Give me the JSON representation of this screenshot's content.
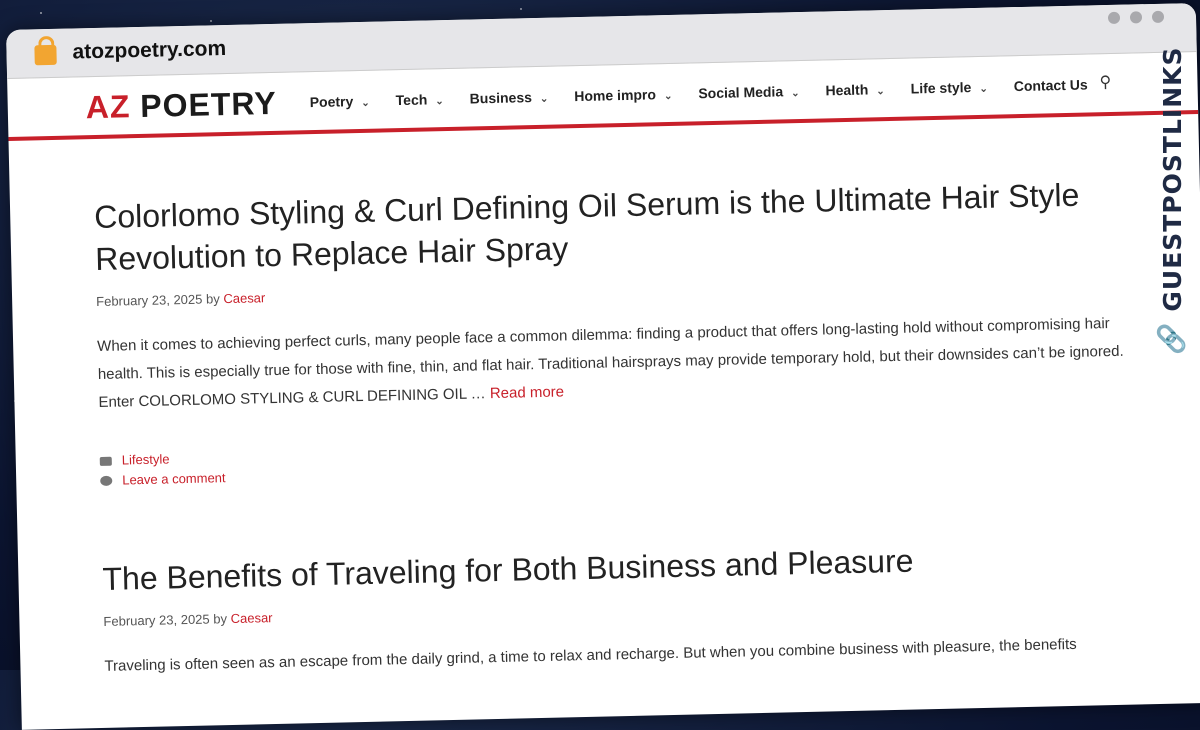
{
  "browser": {
    "url": "atozpoetry.com"
  },
  "site": {
    "logo_prefix": "AZ",
    "logo_text": "POETRY",
    "menu": [
      {
        "label": "Poetry",
        "has_dropdown": true
      },
      {
        "label": "Tech",
        "has_dropdown": true
      },
      {
        "label": "Business",
        "has_dropdown": true
      },
      {
        "label": "Home impro",
        "has_dropdown": true
      },
      {
        "label": "Social Media",
        "has_dropdown": true
      },
      {
        "label": "Health",
        "has_dropdown": true
      },
      {
        "label": "Life style",
        "has_dropdown": true
      },
      {
        "label": "Contact Us",
        "has_dropdown": false
      }
    ]
  },
  "posts": [
    {
      "title": "Colorlomo Styling & Curl Defining Oil Serum is the Ultimate Hair Style Revolution to Replace Hair Spray",
      "date": "February 23, 2025",
      "by": "by",
      "author": "Caesar",
      "excerpt": "When it comes to achieving perfect curls, many people face a common dilemma: finding a product that offers long-lasting hold without compromising hair health. This is especially true for those with fine, thin, and flat hair. Traditional hairsprays may provide temporary hold, but their downsides can’t be ignored. Enter COLORLOMO STYLING & CURL DEFINING OIL …",
      "read_more": "Read more",
      "category": "Lifestyle",
      "comment": "Leave a comment"
    },
    {
      "title": "The Benefits of Traveling for Both Business and Pleasure",
      "date": "February 23, 2025",
      "by": "by",
      "author": "Caesar",
      "excerpt": "Traveling is often seen as an escape from the daily grind, a time to relax and recharge. But when you combine business with pleasure, the benefits"
    }
  ],
  "watermark": "GUESTPOSTLINKS",
  "colors": {
    "accent": "#c8202a",
    "watermark_icon": "#ff5a2a"
  }
}
